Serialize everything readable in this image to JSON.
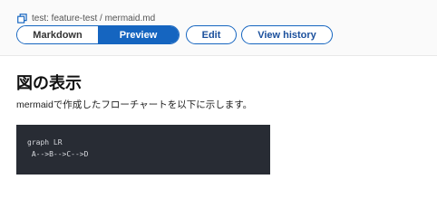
{
  "breadcrumb": {
    "text": "test: feature-test / mermaid.md",
    "icon": "copy-icon"
  },
  "view_toggle": {
    "markdown_label": "Markdown",
    "preview_label": "Preview",
    "active": "Preview"
  },
  "actions": {
    "edit_label": "Edit",
    "history_label": "View history"
  },
  "content": {
    "heading": "図の表示",
    "description": "mermaidで作成したフローチャートを以下に示します。",
    "code_lines": [
      "graph LR",
      " A-->B-->C-->D"
    ]
  },
  "colors": {
    "accent": "#1565c0",
    "code_bg": "#282c34",
    "code_text": "#d7d9de"
  }
}
